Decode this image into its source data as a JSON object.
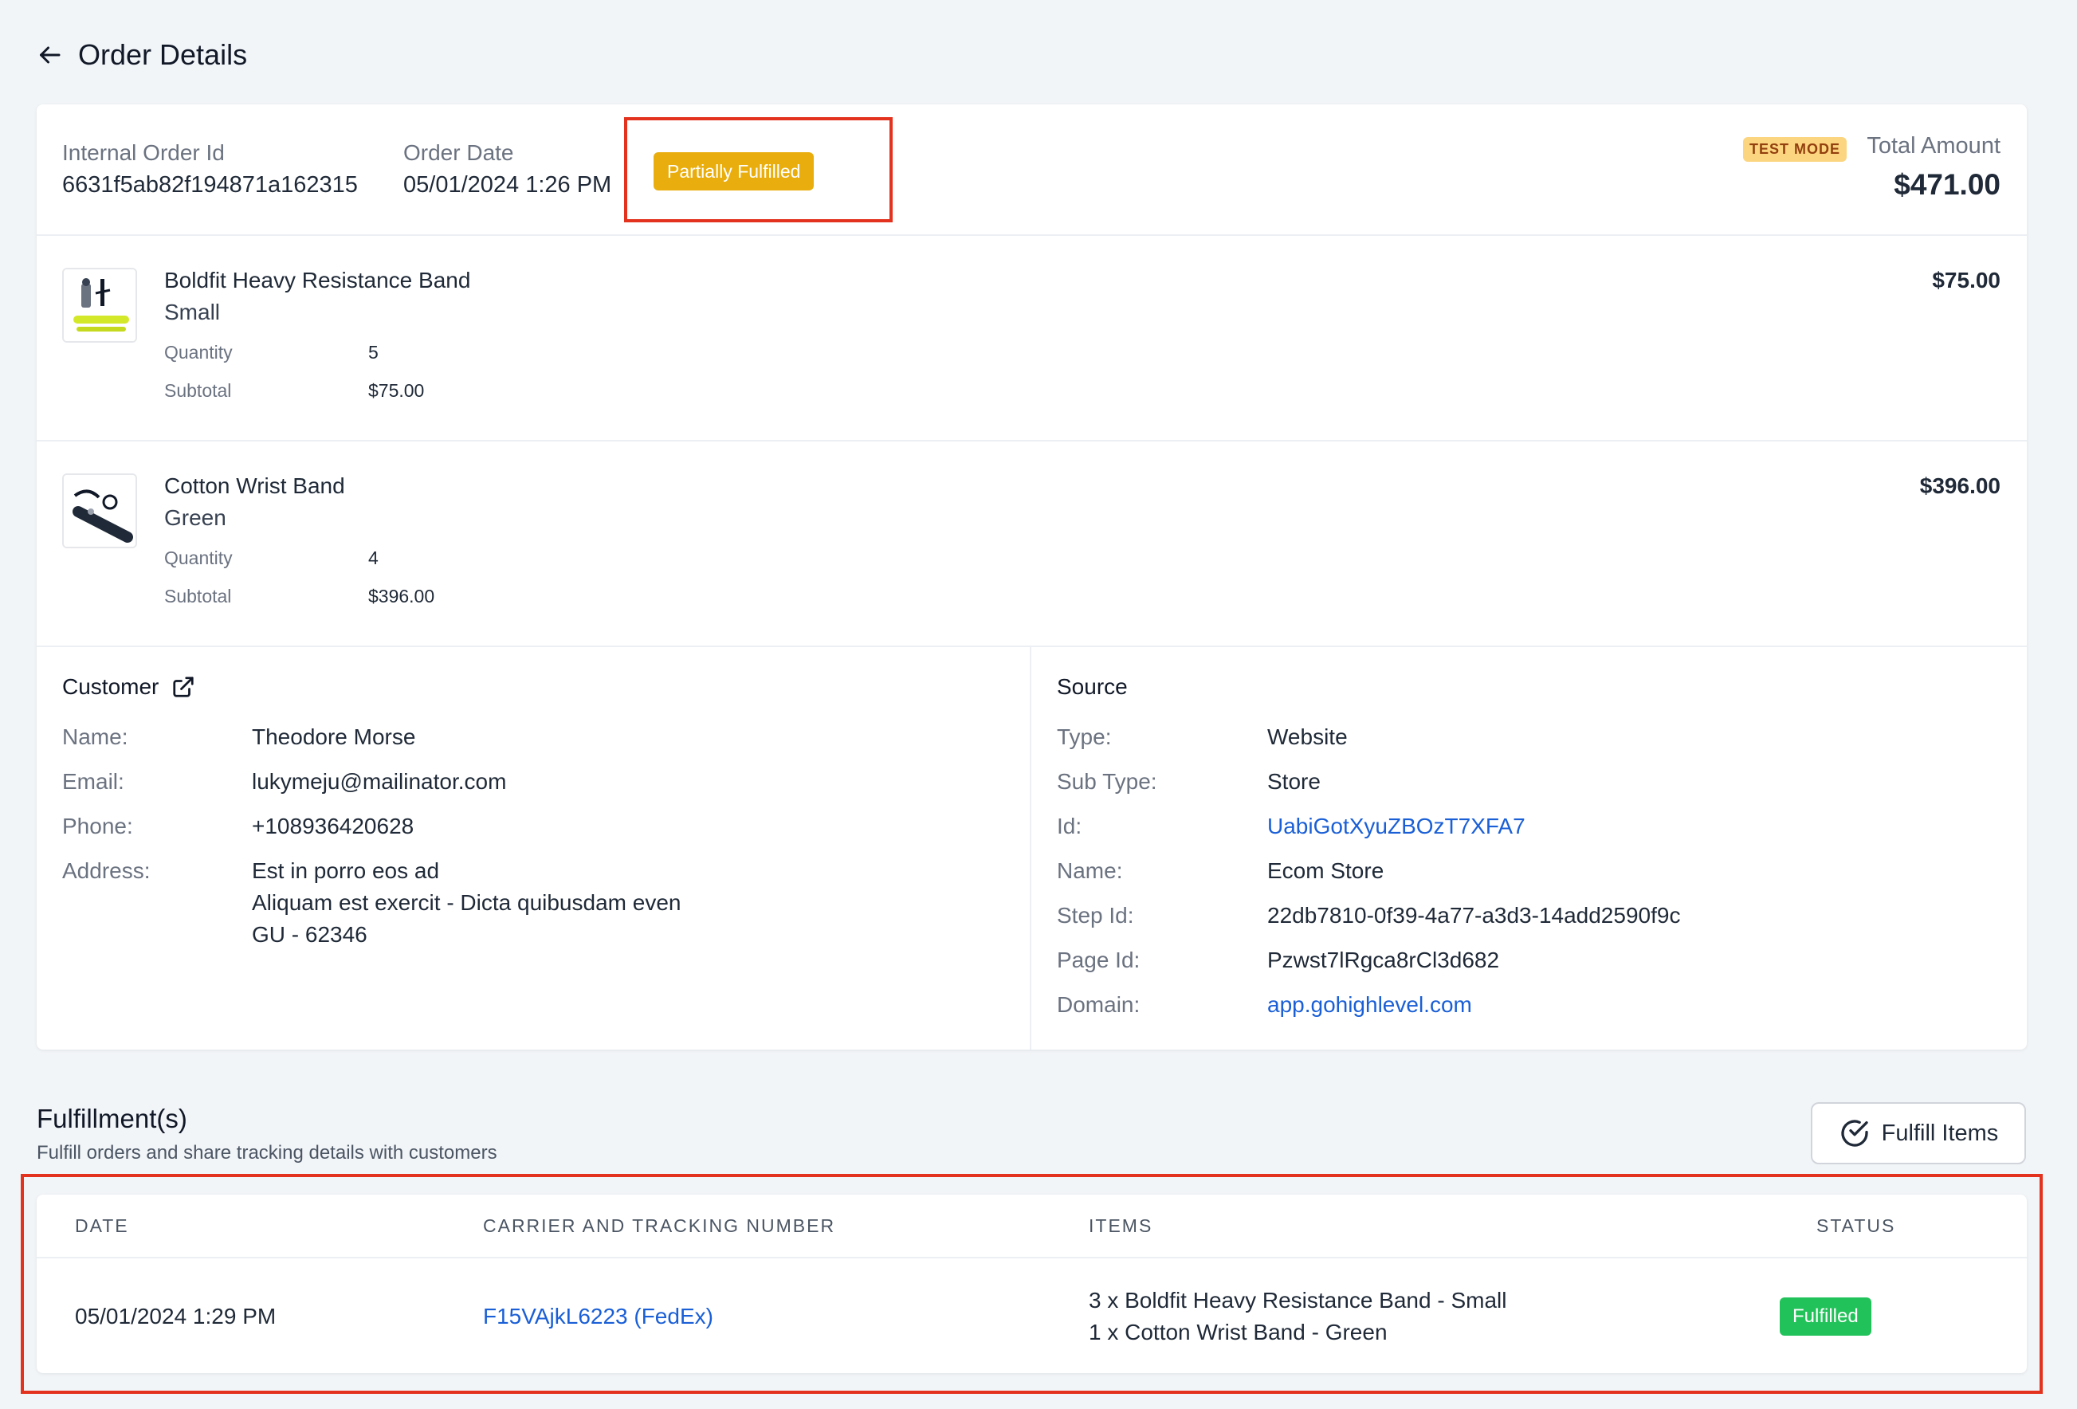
{
  "header": {
    "title": "Order Details",
    "back_icon": "arrow-left-icon"
  },
  "order": {
    "internal_id_label": "Internal Order Id",
    "internal_id": "6631f5ab82f194871a162315",
    "date_label": "Order Date",
    "date": "05/01/2024 1:26 PM",
    "status": "Partially Fulfilled",
    "test_mode": "TEST MODE",
    "total_label": "Total Amount",
    "total": "$471.00"
  },
  "items": [
    {
      "name": "Boldfit Heavy Resistance Band",
      "variant": "Small",
      "quantity_label": "Quantity",
      "quantity": "5",
      "subtotal_label": "Subtotal",
      "subtotal": "$75.00",
      "price": "$75.00"
    },
    {
      "name": "Cotton Wrist Band",
      "variant": "Green",
      "quantity_label": "Quantity",
      "quantity": "4",
      "subtotal_label": "Subtotal",
      "subtotal": "$396.00",
      "price": "$396.00"
    }
  ],
  "customer": {
    "title": "Customer",
    "name_label": "Name:",
    "name": "Theodore Morse",
    "email_label": "Email:",
    "email": "lukymeju@mailinator.com",
    "phone_label": "Phone:",
    "phone": "+108936420628",
    "address_label": "Address:",
    "address_line1": "Est in porro eos ad",
    "address_line2": "Aliquam est exercit - Dicta quibusdam even",
    "address_line3": "GU - 62346"
  },
  "source": {
    "title": "Source",
    "type_label": "Type:",
    "type": "Website",
    "subtype_label": "Sub Type:",
    "subtype": "Store",
    "id_label": "Id:",
    "id": "UabiGotXyuZBOzT7XFA7",
    "name_label": "Name:",
    "name": "Ecom Store",
    "step_label": "Step Id:",
    "step": "22db7810-0f39-4a77-a3d3-14add2590f9c",
    "page_label": "Page Id:",
    "page": "Pzwst7lRgca8rCl3d682",
    "domain_label": "Domain:",
    "domain": "app.gohighlevel.com"
  },
  "fulfillments": {
    "title": "Fulfillment(s)",
    "subtitle": "Fulfill orders and share tracking details with customers",
    "button": "Fulfill Items",
    "columns": [
      "DATE",
      "CARRIER AND TRACKING NUMBER",
      "ITEMS",
      "STATUS"
    ],
    "rows": [
      {
        "date": "05/01/2024 1:29 PM",
        "tracking": "F15VAjkL6223 (FedEx)",
        "item_line1": "3 x Boldfit Heavy Resistance Band - Small",
        "item_line2": "1 x Cotton Wrist Band - Green",
        "status": "Fulfilled"
      }
    ]
  },
  "colors": {
    "partial_badge": "#e9ad0d",
    "fulfilled_badge": "#22c25a",
    "link": "#1a5fd6",
    "highlight": "#e3331f"
  }
}
